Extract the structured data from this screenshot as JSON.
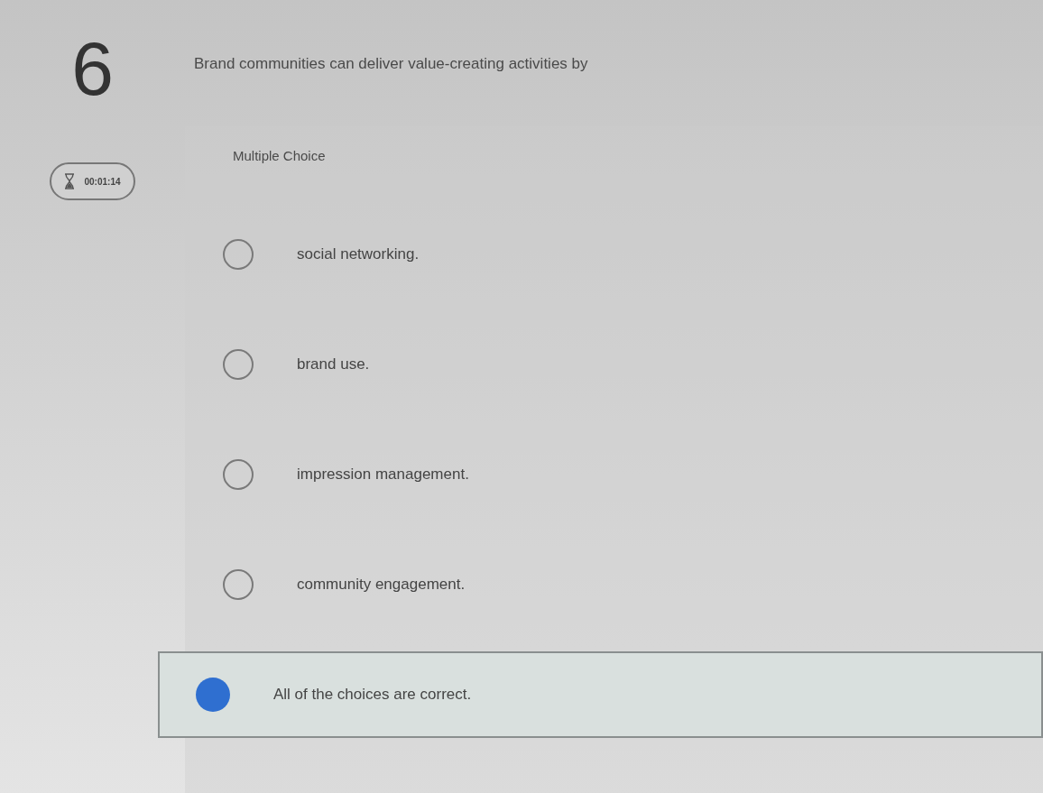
{
  "question": {
    "number": "6",
    "text": "Brand communities can deliver value-creating activities by"
  },
  "timer": {
    "time": "00:01:14"
  },
  "answer_panel": {
    "type_label": "Multiple Choice",
    "choices": [
      {
        "label": "social networking.",
        "selected": false
      },
      {
        "label": "brand use.",
        "selected": false
      },
      {
        "label": "impression management.",
        "selected": false
      },
      {
        "label": "community engagement.",
        "selected": false
      },
      {
        "label": "All of the choices are correct.",
        "selected": true
      }
    ]
  }
}
